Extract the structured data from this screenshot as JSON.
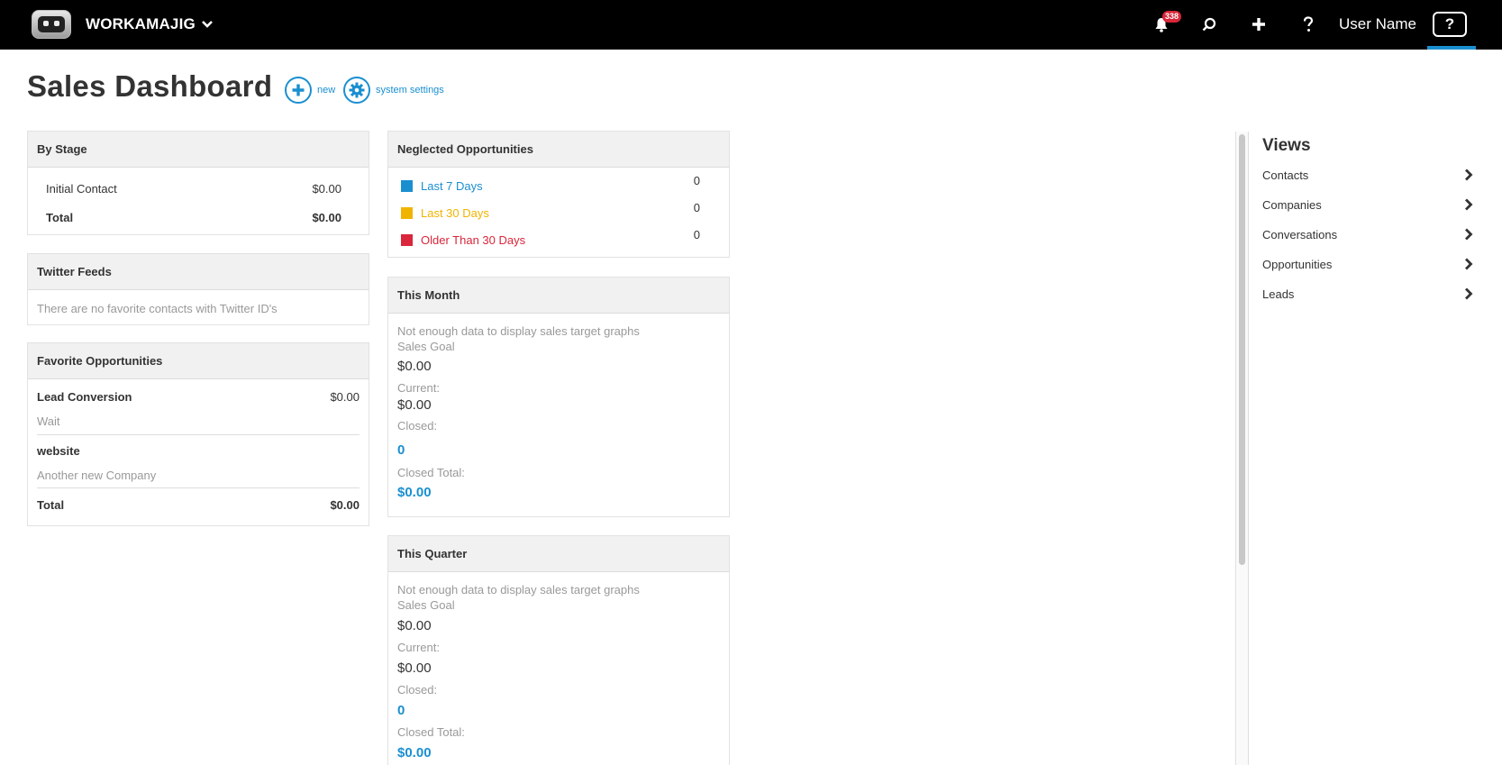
{
  "topbar": {
    "brand": "WORKAMAJIG",
    "notification_count": "338",
    "username": "User Name",
    "help_label": "?"
  },
  "page": {
    "title": "Sales Dashboard",
    "actions": {
      "new_label": "new",
      "settings_label": "system settings"
    }
  },
  "by_stage": {
    "title": "By Stage",
    "rows": [
      {
        "label": "Initial Contact",
        "value": "$0.00"
      }
    ],
    "total_label": "Total",
    "total_value": "$0.00"
  },
  "twitter": {
    "title": "Twitter Feeds",
    "empty_text": "There are no favorite contacts with Twitter ID's"
  },
  "favorites": {
    "title": "Favorite Opportunities",
    "items": [
      {
        "name": "Lead Conversion",
        "value": "$0.00",
        "sub": "Wait"
      },
      {
        "name": "website",
        "value": "",
        "sub": "Another new Company"
      }
    ],
    "total_label": "Total",
    "total_value": "$0.00"
  },
  "neglected": {
    "title": "Neglected Opportunities",
    "rows": [
      {
        "label": "Last 7 Days",
        "value": "0",
        "color": "#1a8fd0"
      },
      {
        "label": "Last 30 Days",
        "value": "0",
        "color": "#f0b400"
      },
      {
        "label": "Older Than 30 Days",
        "value": "0",
        "color": "#d9263a"
      }
    ]
  },
  "this_month": {
    "title": "This Month",
    "note": "Not enough data to display sales target graphs",
    "goal_label": "Sales Goal",
    "goal_value": "$0.00",
    "current_label": "Current:",
    "current_value": "$0.00",
    "closed_label": "Closed:",
    "closed_value": "0",
    "closed_total_label": "Closed Total:",
    "closed_total_value": "$0.00"
  },
  "this_quarter": {
    "title": "This Quarter",
    "note": "Not enough data to display sales target graphs",
    "goal_label": "Sales Goal",
    "goal_value": "$0.00",
    "current_label": "Current:",
    "current_value": "$0.00",
    "closed_label": "Closed:",
    "closed_value": "0",
    "closed_total_label": "Closed Total:",
    "closed_total_value": "$0.00"
  },
  "views": {
    "title": "Views",
    "items": [
      "Contacts",
      "Companies",
      "Conversations",
      "Opportunities",
      "Leads"
    ]
  },
  "colors": {
    "accent": "#1a8fd0",
    "topbar": "#000000",
    "badge": "#d9263a"
  },
  "icons": {
    "logo": "robot-logo-icon",
    "brand_dropdown": "chevron-down-icon",
    "notifications": "bell-icon",
    "search": "search-icon",
    "add": "plus-icon",
    "help": "question-icon",
    "help_box": "help-box-icon",
    "new": "plus-circle-icon",
    "settings": "gear-circle-icon",
    "view_item": "chevron-right-icon"
  }
}
